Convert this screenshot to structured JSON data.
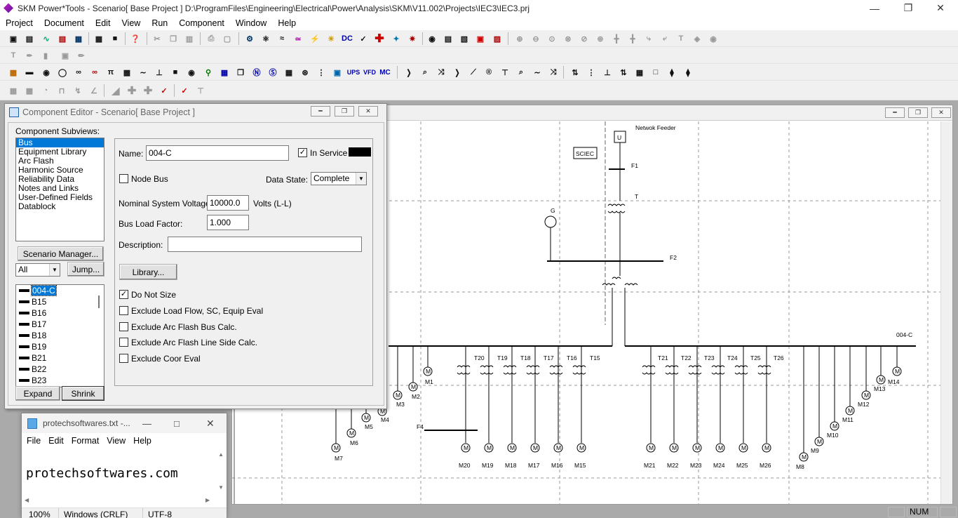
{
  "app": {
    "title": "SKM Power*Tools - Scenario[ Base Project ] D:\\ProgramFiles\\Engineering\\Electrical\\Power\\Analysis\\SKM\\V11.002\\Projects\\IEC3\\IEC3.prj"
  },
  "menu": [
    "Project",
    "Document",
    "Edit",
    "View",
    "Run",
    "Component",
    "Window",
    "Help"
  ],
  "toolbar3_labels": [
    "UPS",
    "VFD",
    "MC"
  ],
  "toolbar2_dc": "DC",
  "component_editor": {
    "title": "Component Editor  - Scenario[ Base Project ]",
    "subviews_label": "Component Subviews:",
    "subviews": [
      "Bus",
      "Equipment Library",
      "Arc Flash",
      "Harmonic Source",
      "Reliability Data",
      "Notes and Links",
      "User-Defined Fields",
      "Datablock"
    ],
    "selected_subview": "Bus",
    "scenario_button": "Scenario Manager...",
    "filter_value": "All",
    "jump_button": "Jump...",
    "bus_list": [
      "004-C",
      "B15",
      "B16",
      "B17",
      "B18",
      "B19",
      "B21",
      "B22",
      "B23"
    ],
    "selected_bus": "004-C",
    "expand_button": "Expand",
    "shrink_button": "Shrink",
    "name_label": "Name:",
    "name_value": "004-C",
    "in_service_label": "In Service",
    "in_service": true,
    "node_bus_label": "Node Bus",
    "node_bus": false,
    "data_state_label": "Data State:",
    "data_state_value": "Complete",
    "nominal_voltage_label": "Nominal System Voltage:",
    "nominal_voltage_value": "10000.0",
    "voltage_unit": "Volts (L-L)",
    "load_factor_label": "Bus Load Factor:",
    "load_factor_value": "1.000",
    "description_label": "Description:",
    "description_value": "",
    "library_button": "Library...",
    "options": [
      {
        "label": "Do Not Size",
        "checked": true
      },
      {
        "label": "Exclude Load Flow, SC, Equip Eval",
        "checked": false
      },
      {
        "label": "Exclude Arc Flash Bus Calc.",
        "checked": false
      },
      {
        "label": "Exclude Arc Flash Line Side Calc.",
        "checked": false
      },
      {
        "label": "Exclude Coor Eval",
        "checked": false
      }
    ]
  },
  "oneline": {
    "network_feeder": "Netwok Feeder",
    "sciec": "SCIEC",
    "utility_symbol": "U",
    "labels": {
      "F1": "F1",
      "T": "T",
      "G": "G",
      "F2": "F2",
      "F4": "F4",
      "bus": "004-C"
    },
    "left_transformers": [
      "T20",
      "T19",
      "T18",
      "T17",
      "T16",
      "T15"
    ],
    "right_transformers": [
      "T21",
      "T22",
      "T23",
      "T24",
      "T25",
      "T26"
    ],
    "left_motors": [
      "M20",
      "M19",
      "M18",
      "M17",
      "M16",
      "M15"
    ],
    "right_motors": [
      "M21",
      "M22",
      "M23",
      "M24",
      "M25",
      "M26"
    ],
    "left_fan_motors": [
      "M1",
      "M2",
      "M3",
      "M4",
      "M5",
      "M6",
      "M7"
    ],
    "right_fan_motors": [
      "M14",
      "M13",
      "M12",
      "M11",
      "M10",
      "M9",
      "M8"
    ]
  },
  "notepad": {
    "title": "protechsoftwares.txt -...",
    "menu": [
      "File",
      "Edit",
      "Format",
      "View",
      "Help"
    ],
    "content": "protechsoftwares.com",
    "zoom": "100%",
    "line_ending": "Windows (CRLF)",
    "encoding": "UTF-8"
  },
  "statusbar": {
    "num": "NUM"
  }
}
